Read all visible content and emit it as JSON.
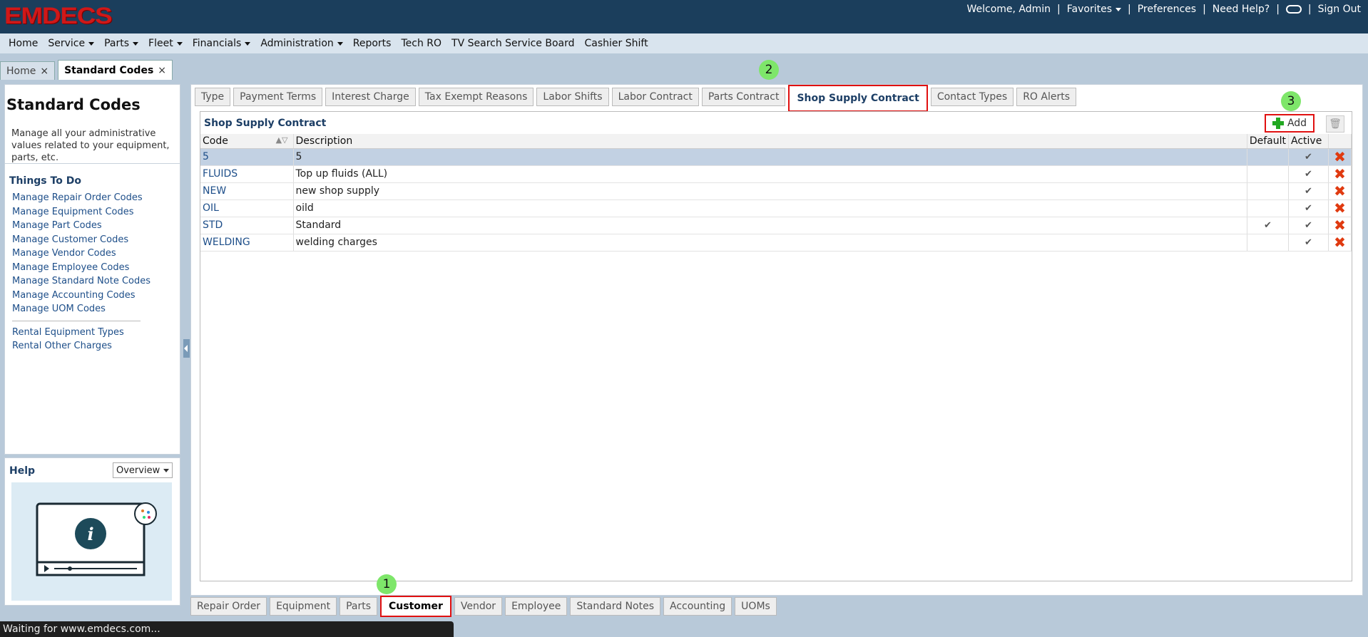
{
  "app": {
    "logo": "EMDECS",
    "top_links": {
      "welcome": "Welcome, Admin",
      "favorites": "Favorites",
      "preferences": "Preferences",
      "need_help": "Need Help?",
      "sign_out": "Sign Out"
    }
  },
  "menu": [
    "Home",
    "Service",
    "Parts",
    "Fleet",
    "Financials",
    "Administration",
    "Reports",
    "Tech RO",
    "TV Search Service Board",
    "Cashier Shift"
  ],
  "doc_tabs": [
    {
      "label": "Home",
      "active": false
    },
    {
      "label": "Standard Codes",
      "active": true
    }
  ],
  "left": {
    "title": "Standard Codes",
    "description": "Manage all your administrative values related to your equipment, parts, etc.",
    "things_title": "Things To Do",
    "links": [
      "Manage Repair Order Codes",
      "Manage Equipment Codes",
      "Manage Part Codes",
      "Manage Customer Codes",
      "Manage Vendor Codes",
      "Manage Employee Codes",
      "Manage Standard Note Codes",
      "Manage Accounting Codes",
      "Manage UOM Codes"
    ],
    "links2": [
      "Rental Equipment Types",
      "Rental Other Charges"
    ],
    "help_title": "Help",
    "help_select": "Overview"
  },
  "sub_tabs": [
    "Type",
    "Payment Terms",
    "Interest Charge",
    "Tax Exempt Reasons",
    "Labor Shifts",
    "Labor Contract",
    "Parts Contract",
    "Shop Supply Contract",
    "Contact Types",
    "RO Alerts"
  ],
  "grid": {
    "title": "Shop Supply Contract",
    "add_label": "Add",
    "columns": {
      "code": "Code",
      "description": "Description",
      "default": "Default",
      "active": "Active"
    },
    "rows": [
      {
        "code": "5",
        "description": "5",
        "default": "",
        "active": "✔"
      },
      {
        "code": "FLUIDS",
        "description": "Top up fluids (ALL)",
        "default": "",
        "active": "✔"
      },
      {
        "code": "NEW",
        "description": "new shop supply",
        "default": "",
        "active": "✔"
      },
      {
        "code": "OIL",
        "description": "oild",
        "default": "",
        "active": "✔"
      },
      {
        "code": "STD",
        "description": "Standard",
        "default": "✔",
        "active": "✔"
      },
      {
        "code": "WELDING",
        "description": "welding charges",
        "default": "",
        "active": "✔"
      }
    ]
  },
  "bottom_tabs": [
    "Repair Order",
    "Equipment",
    "Parts",
    "Customer",
    "Vendor",
    "Employee",
    "Standard Notes",
    "Accounting",
    "UOMs"
  ],
  "badges": {
    "b1": "1",
    "b2": "2",
    "b3": "3"
  },
  "status": "Waiting for www.emdecs.com..."
}
